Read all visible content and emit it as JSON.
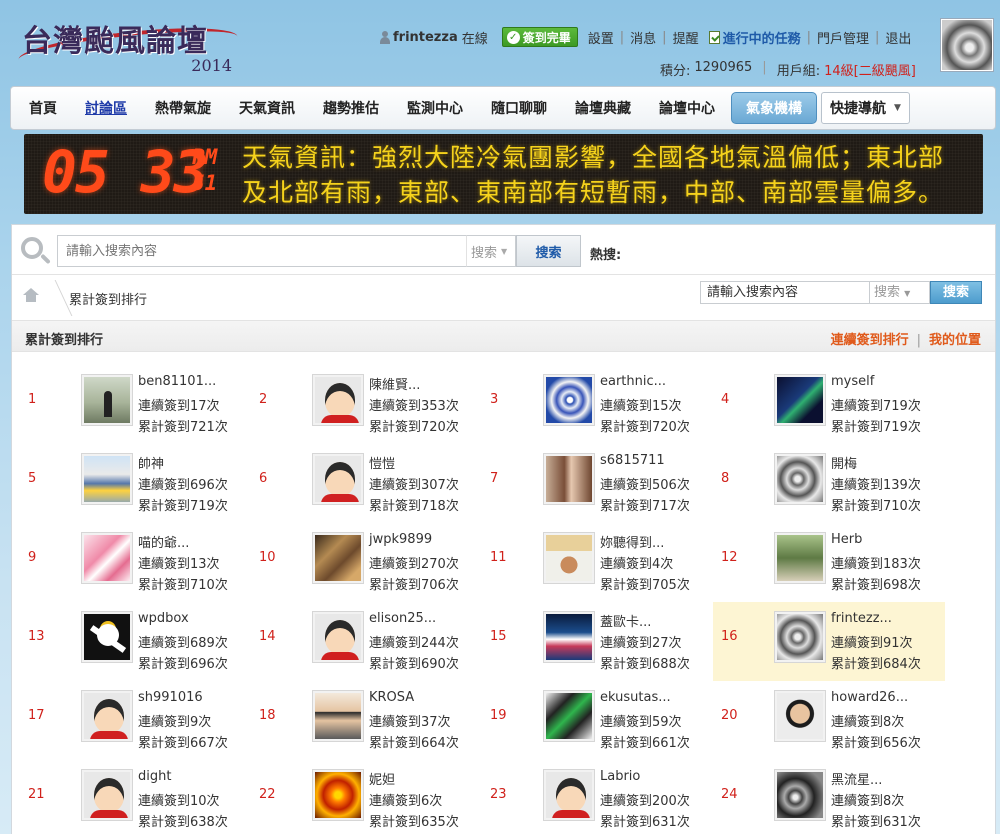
{
  "site": {
    "title": "台灣颱風論壇",
    "year": "2014"
  },
  "topbar": {
    "username": "frintezza",
    "online": "在線",
    "sign_badge": "簽到完畢",
    "links": [
      "設置",
      "消息",
      "提醒"
    ],
    "task": "進行中的任務",
    "portal": "門戶管理",
    "logout": "退出"
  },
  "subbar": {
    "points_label": "積分:",
    "points": "1290965",
    "group_label": "用戶組:",
    "group": "14級[二級颶風]"
  },
  "nav": {
    "items": [
      "首頁",
      "討論區",
      "熱帶氣旋",
      "天氣資訊",
      "趨勢推估",
      "監測中心",
      "隨口聊聊",
      "論壇典藏",
      "論壇中心",
      "氣象機構"
    ],
    "quick": "快捷導航"
  },
  "banner": {
    "time": "05 33",
    "ampm": "PM",
    "seconds": "51",
    "text": "天氣資訊：強烈大陸冷氣團影響，全國各地氣溫偏低；東北部及北部有雨，東部、東南部有短暫雨，中部、南部雲量偏多。"
  },
  "search": {
    "placeholder": "請輸入搜索內容",
    "type": "搜索",
    "button": "搜索",
    "hot_label": "熱搜:"
  },
  "breadcrumb": {
    "current": "累計簽到排行",
    "search_value": "請輸入搜索內容",
    "search_type": "搜索",
    "search_button": "搜索"
  },
  "section": {
    "title": "累計簽到排行",
    "link_streak": "連續簽到排行",
    "link_me": "我的位置"
  },
  "ranking": [
    {
      "rank": "1",
      "name": "ben81101...",
      "streak": "連續簽到17次",
      "total": "累計簽到721次",
      "avatar": "silhouette"
    },
    {
      "rank": "2",
      "name": "陳維賢...",
      "streak": "連續簽到353次",
      "total": "累計簽到720次",
      "avatar": "default"
    },
    {
      "rank": "3",
      "name": "earthnic...",
      "streak": "連續簽到15次",
      "total": "累計簽到720次",
      "avatar": "typhoon"
    },
    {
      "rank": "4",
      "name": "myself",
      "streak": "連續簽到719次",
      "total": "累計簽到719次",
      "avatar": "night"
    },
    {
      "rank": "5",
      "name": "帥神",
      "streak": "連續簽到696次",
      "total": "累計簽到719次",
      "avatar": "train"
    },
    {
      "rank": "6",
      "name": "愷愷",
      "streak": "連續簽到307次",
      "total": "累計簽到718次",
      "avatar": "default"
    },
    {
      "rank": "7",
      "name": "s6815711",
      "streak": "連續簽到506次",
      "total": "累計簽到717次",
      "avatar": "girl"
    },
    {
      "rank": "8",
      "name": "開梅",
      "streak": "連續簽到139次",
      "total": "累計簽到710次",
      "avatar": "storm"
    },
    {
      "rank": "9",
      "name": "喵的爺...",
      "streak": "連續簽到13次",
      "total": "累計簽到710次",
      "avatar": "anime"
    },
    {
      "rank": "10",
      "name": "jwpk9899",
      "streak": "連續簽到270次",
      "total": "累計簽到706次",
      "avatar": "warrior"
    },
    {
      "rank": "11",
      "name": "妳聽得到...",
      "streak": "連續簽到4次",
      "total": "累計簽到705次",
      "avatar": "hat"
    },
    {
      "rank": "12",
      "name": "Herb",
      "streak": "連續簽到183次",
      "total": "累計簽到698次",
      "avatar": "man"
    },
    {
      "rank": "13",
      "name": "wpdbox",
      "streak": "連續簽到689次",
      "total": "累計簽到696次",
      "avatar": "onepiece"
    },
    {
      "rank": "14",
      "name": "elison25...",
      "streak": "連續簽到244次",
      "total": "累計簽到690次",
      "avatar": "default"
    },
    {
      "rank": "15",
      "name": "蓋歐卡...",
      "streak": "連續簽到27次",
      "total": "累計簽到688次",
      "avatar": "aurora"
    },
    {
      "rank": "16",
      "name": "frintezz...",
      "streak": "連續簽到91次",
      "total": "累計簽到684次",
      "avatar": "storm",
      "me": true
    },
    {
      "rank": "17",
      "name": "sh991016",
      "streak": "連續簽到9次",
      "total": "累計簽到667次",
      "avatar": "default"
    },
    {
      "rank": "18",
      "name": "KROSA",
      "streak": "連續簽到37次",
      "total": "累計簽到664次",
      "avatar": "boy"
    },
    {
      "rank": "19",
      "name": "ekusutas...",
      "streak": "連續簽到59次",
      "total": "累計簽到661次",
      "avatar": "phone"
    },
    {
      "rank": "20",
      "name": "howard26...",
      "streak": "連續簽到8次",
      "total": "累計簽到656次",
      "avatar": "asian"
    },
    {
      "rank": "21",
      "name": "dight",
      "streak": "連續簽到10次",
      "total": "累計簽到638次",
      "avatar": "default"
    },
    {
      "rank": "22",
      "name": "妮妲",
      "streak": "連續簽到6次",
      "total": "累計簽到635次",
      "avatar": "sat"
    },
    {
      "rank": "23",
      "name": "Labrio",
      "streak": "連續簽到200次",
      "total": "累計簽到631次",
      "avatar": "default"
    },
    {
      "rank": "24",
      "name": "黑流星...",
      "streak": "連續簽到8次",
      "total": "累計簽到631次",
      "avatar": "grey"
    }
  ]
}
